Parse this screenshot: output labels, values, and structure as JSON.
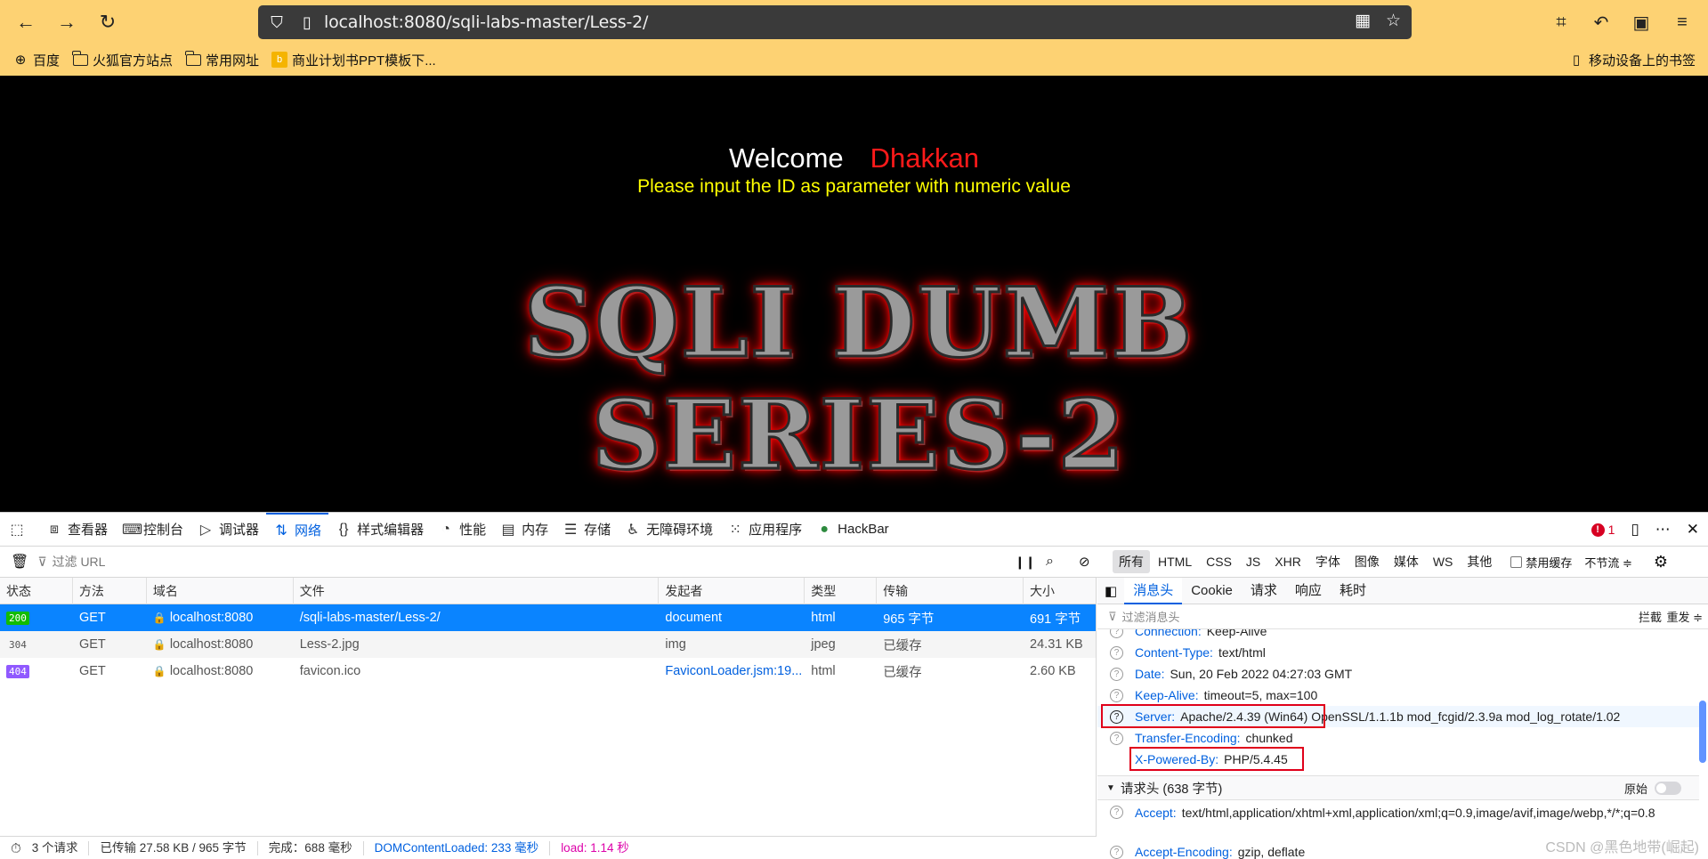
{
  "browser": {
    "url": "localhost:8080/sqli-labs-master/Less-2/",
    "bookmarks": [
      "百度",
      "火狐官方站点",
      "常用网址",
      "商业计划书PPT模板下..."
    ],
    "mobile_bookmarks": "移动设备上的书签"
  },
  "page": {
    "welcome": "Welcome",
    "name": "Dhakkan",
    "instruction": "Please input the ID as parameter with numeric value",
    "banner": "SQLI DUMB SERIES-2"
  },
  "devtools": {
    "tabs": [
      "查看器",
      "控制台",
      "调试器",
      "网络",
      "样式编辑器",
      "性能",
      "内存",
      "存储",
      "无障碍环境",
      "应用程序",
      "HackBar"
    ],
    "error_count": "1",
    "filter_url_placeholder": "过滤 URL",
    "type_filters": [
      "所有",
      "HTML",
      "CSS",
      "JS",
      "XHR",
      "字体",
      "图像",
      "媒体",
      "WS",
      "其他"
    ],
    "disable_cache": "禁用缓存",
    "throttle": "不节流 ≑",
    "columns": [
      "状态",
      "方法",
      "域名",
      "文件",
      "发起者",
      "类型",
      "传输",
      "大小"
    ],
    "requests": [
      {
        "status": "200",
        "method": "GET",
        "domain": "localhost:8080",
        "file": "/sqli-labs-master/Less-2/",
        "initiator": "document",
        "type": "html",
        "transfer": "965 字节",
        "size": "691 字节"
      },
      {
        "status": "304",
        "method": "GET",
        "domain": "localhost:8080",
        "file": "Less-2.jpg",
        "initiator": "img",
        "type": "jpeg",
        "transfer": "已缓存",
        "size": "24.31 KB"
      },
      {
        "status": "404",
        "method": "GET",
        "domain": "localhost:8080",
        "file": "favicon.ico",
        "initiator": "FaviconLoader.jsm:19...",
        "type": "html",
        "transfer": "已缓存",
        "size": "2.60 KB"
      }
    ],
    "status_bar": {
      "requests": "3 个请求",
      "transferred": "已传输 27.58 KB / 965 字节",
      "finish": "完成：688 毫秒",
      "dom_loaded": "DOMContentLoaded: 233 毫秒",
      "load": "load: 1.14 秒"
    },
    "panel_tabs": [
      "消息头",
      "Cookie",
      "请求",
      "响应",
      "耗时"
    ],
    "header_filter_placeholder": "过滤消息头",
    "block": "拦截",
    "resend": "重发 ≑",
    "response_headers": [
      {
        "key": "Connection:",
        "value": "Keep-Alive"
      },
      {
        "key": "Content-Type:",
        "value": "text/html"
      },
      {
        "key": "Date:",
        "value": "Sun, 20 Feb 2022 04:27:03 GMT"
      },
      {
        "key": "Keep-Alive:",
        "value": "timeout=5, max=100"
      },
      {
        "key": "Server:",
        "value": "Apache/2.4.39 (Win64) OpenSSL/1.1.1b mod_fcgid/2.3.9a mod_log_rotate/1.02"
      },
      {
        "key": "Transfer-Encoding:",
        "value": "chunked"
      },
      {
        "key": "X-Powered-By:",
        "value": "PHP/5.4.45"
      }
    ],
    "request_headers_title": "请求头 (638 字节)",
    "raw_label": "原始",
    "request_headers": [
      {
        "key": "Accept:",
        "value": "text/html,application/xhtml+xml,application/xml;q=0.9,image/avif,image/webp,*/*;q=0.8"
      },
      {
        "key": "Accept-Encoding:",
        "value": "gzip, deflate"
      }
    ],
    "watermark": "CSDN @黑色地带(崛起)"
  }
}
